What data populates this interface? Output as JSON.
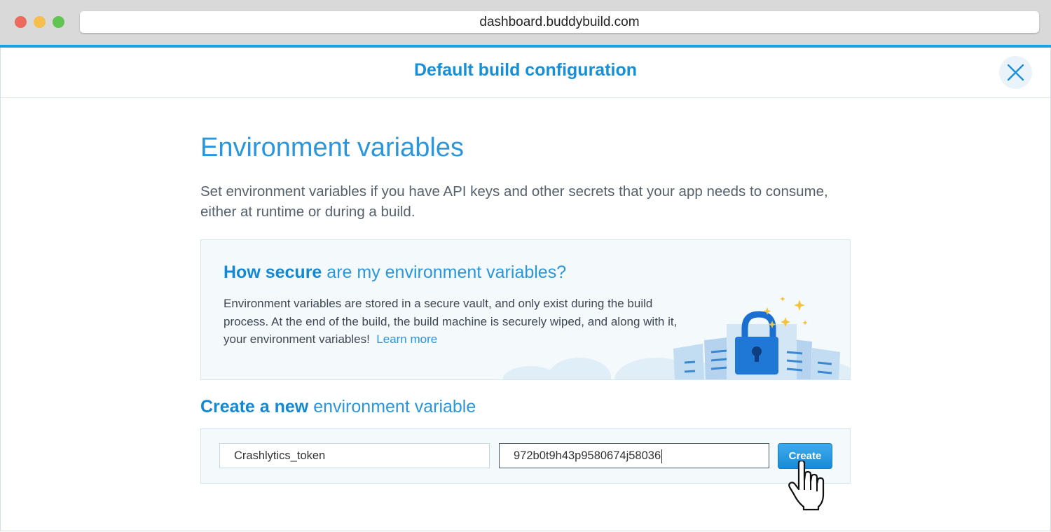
{
  "browser": {
    "url": "dashboard.buddybuild.com"
  },
  "header": {
    "title": "Default build configuration"
  },
  "section": {
    "title": "Environment variables",
    "intro": "Set environment variables if you have API keys and other secrets that your app needs to consume, either at runtime or during a build."
  },
  "secure_box": {
    "heading_bold": "How secure",
    "heading_rest": " are my environment variables?",
    "body": "Environment variables are stored in a secure vault, and only exist during the build process. At the end of the build, the build machine is securely wiped, and along with it, your environment variables!",
    "link": "Learn more"
  },
  "create": {
    "title_bold": "Create a new",
    "title_rest": " environment variable",
    "name_value": "Crashlytics_token",
    "value_value": "972b0t9h43p9580674j58036",
    "button_label": "Create"
  },
  "icons": [
    "close-icon",
    "padlock-illustration",
    "hand-cursor-icon"
  ],
  "colors": {
    "accent": "#1aa0e6",
    "title": "#1590d8",
    "button": "#2a96dd"
  }
}
